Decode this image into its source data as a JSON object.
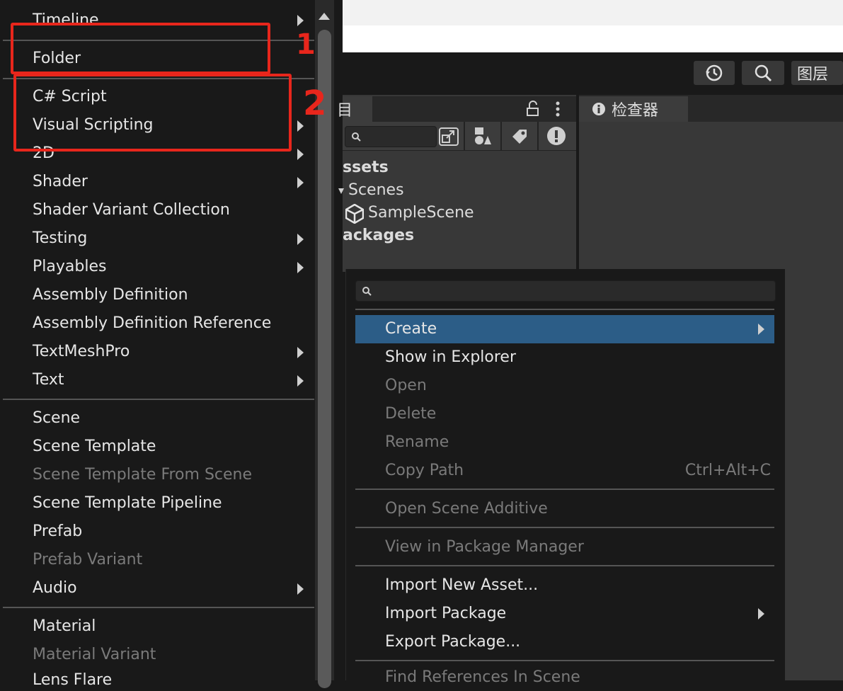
{
  "left_menu": {
    "items": [
      {
        "label": "Timeline",
        "arrow": true,
        "dim": false
      },
      {
        "label": "Folder",
        "arrow": false,
        "dim": false
      },
      {
        "label": "C# Script",
        "arrow": false,
        "dim": false
      },
      {
        "label": "Visual Scripting",
        "arrow": true,
        "dim": false
      },
      {
        "label": "2D",
        "arrow": true,
        "dim": false
      },
      {
        "label": "Shader",
        "arrow": true,
        "dim": false
      },
      {
        "label": "Shader Variant Collection",
        "arrow": false,
        "dim": false
      },
      {
        "label": "Testing",
        "arrow": true,
        "dim": false
      },
      {
        "label": "Playables",
        "arrow": true,
        "dim": false
      },
      {
        "label": "Assembly Definition",
        "arrow": false,
        "dim": false
      },
      {
        "label": "Assembly Definition Reference",
        "arrow": false,
        "dim": false
      },
      {
        "label": "TextMeshPro",
        "arrow": true,
        "dim": false
      },
      {
        "label": "Text",
        "arrow": true,
        "dim": false
      },
      {
        "label": "Scene",
        "arrow": false,
        "dim": false
      },
      {
        "label": "Scene Template",
        "arrow": false,
        "dim": false
      },
      {
        "label": "Scene Template From Scene",
        "arrow": false,
        "dim": true
      },
      {
        "label": "Scene Template Pipeline",
        "arrow": false,
        "dim": false
      },
      {
        "label": "Prefab",
        "arrow": false,
        "dim": false
      },
      {
        "label": "Prefab Variant",
        "arrow": false,
        "dim": true
      },
      {
        "label": "Audio",
        "arrow": true,
        "dim": false
      },
      {
        "label": "Material",
        "arrow": false,
        "dim": false
      },
      {
        "label": "Material Variant",
        "arrow": false,
        "dim": true
      },
      {
        "label": "Lens Flare",
        "arrow": false,
        "dim": false
      }
    ]
  },
  "toolbar": {
    "history_icon": "history-icon",
    "search_icon": "search-icon",
    "layers_label": "图层"
  },
  "project_panel": {
    "tab_label": "目",
    "lock_icon": "lock-icon",
    "more_icon": "kebab-icon",
    "tree": {
      "assets": "ssets",
      "scenes": "Scenes",
      "sample_scene": "SampleScene",
      "packages": "ackages"
    }
  },
  "inspector": {
    "tab_label": "检查器",
    "info_icon": "info-icon"
  },
  "context_menu": {
    "items": [
      {
        "label": "Create",
        "shortcut": "",
        "arrow": true,
        "dim": false,
        "highlighted": true
      },
      {
        "label": "Show in Explorer",
        "shortcut": "",
        "arrow": false,
        "dim": false
      },
      {
        "label": "Open",
        "shortcut": "",
        "arrow": false,
        "dim": true
      },
      {
        "label": "Delete",
        "shortcut": "",
        "arrow": false,
        "dim": true
      },
      {
        "label": "Rename",
        "shortcut": "",
        "arrow": false,
        "dim": true
      },
      {
        "label": "Copy Path",
        "shortcut": "Ctrl+Alt+C",
        "arrow": false,
        "dim": true
      },
      {
        "label": "Open Scene Additive",
        "shortcut": "",
        "arrow": false,
        "dim": true
      },
      {
        "label": "View in Package Manager",
        "shortcut": "",
        "arrow": false,
        "dim": true
      },
      {
        "label": "Import New Asset...",
        "shortcut": "",
        "arrow": false,
        "dim": false
      },
      {
        "label": "Import Package",
        "shortcut": "",
        "arrow": true,
        "dim": false
      },
      {
        "label": "Export Package...",
        "shortcut": "",
        "arrow": false,
        "dim": false
      },
      {
        "label": "Find References In Scene",
        "shortcut": "",
        "arrow": false,
        "dim": true
      }
    ]
  },
  "annotations": {
    "box1_label": "1",
    "box2_label": "2",
    "color": "#e8261c"
  },
  "colors": {
    "highlight": "#2c5d87",
    "menu_bg": "#191919",
    "panel_bg": "#383838"
  }
}
